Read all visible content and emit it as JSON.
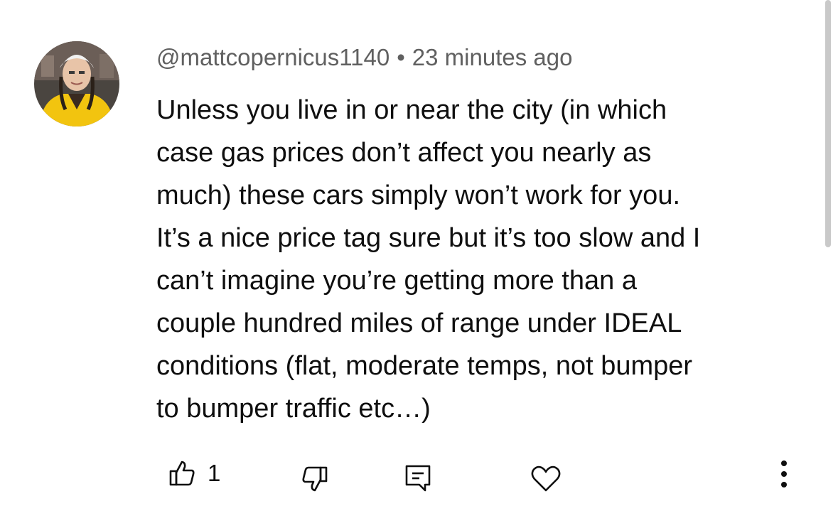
{
  "comment": {
    "author": "@mattcopernicus1140",
    "separator": "•",
    "timestamp": "23 minutes ago",
    "text": "Unless you live in or near the city (in which\ncase gas prices don’t affect you nearly as\nmuch) these cars simply won’t work for you.\nIt’s a nice price tag sure but it’s too slow and I\ncan’t imagine you’re getting more than a\ncouple hundred miles of range under IDEAL\nconditions (flat, moderate temps, not bumper\nto bumper traffic etc…)",
    "like_count": "1"
  },
  "icons": {
    "like": "thumbs-up-icon",
    "dislike": "thumbs-down-icon",
    "reply": "reply-comment-icon",
    "heart": "heart-icon",
    "more": "more-vertical-icon"
  },
  "colors": {
    "meta_text": "#606060",
    "body_text": "#0f0f0f",
    "avatar_coat": "#f2c40f"
  }
}
